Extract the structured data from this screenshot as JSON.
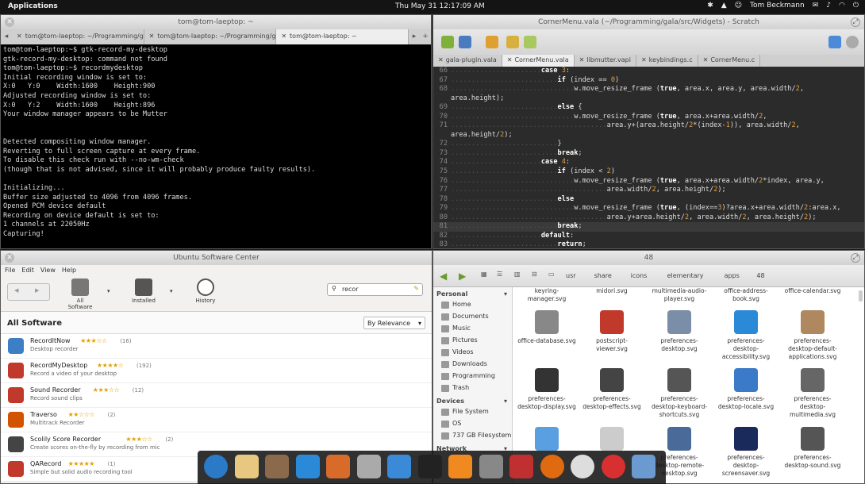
{
  "panel": {
    "apps": "Applications",
    "clock": "Thu May 31 12:17:09 AM",
    "user": "Tom Beckmann"
  },
  "terminal": {
    "title": "tom@tom-laeptop: ~",
    "tabs": [
      "tom@tom-laeptop: ~/Programming/gala/build",
      "tom@tom-laeptop: ~/Programming/gala/build",
      "tom@tom-laeptop: ~"
    ],
    "lines": [
      "tom@tom-laeptop:~$ gtk-record-my-desktop",
      "gtk-record-my-desktop: command not found",
      "tom@tom-laeptop:~$ recordmydesktop",
      "Initial recording window is set to:",
      "X:0   Y:0    Width:1600    Height:900",
      "Adjusted recording window is set to:",
      "X:0   Y:2    Width:1600    Height:896",
      "Your window manager appears to be Mutter",
      "",
      "",
      "Detected compositing window manager.",
      "Reverting to full screen capture at every frame.",
      "To disable this check run with --no-wm-check",
      "(though that is not advised, since it will probably produce faulty results).",
      "",
      "Initializing...",
      "Buffer size adjusted to 4096 from 4096 frames.",
      "Opened PCM device default",
      "Recording on device default is set to:",
      "1 channels at 22050Hz",
      "Capturing!"
    ]
  },
  "editor": {
    "title": "CornerMenu.vala (~/Programming/gala/src/Widgets) - Scratch",
    "tabs": [
      "gala-plugin.vala",
      "CornerMenu.vala",
      "libmutter.vapi",
      "keybindings.c",
      "CornerMenu.c"
    ],
    "lines": [
      {
        "n": "66",
        "t": "......................case 3:"
      },
      {
        "n": "67",
        "t": "..........................if (index == 0)"
      },
      {
        "n": "68",
        "t": "..............................w.move_resize_frame (true, area.x, area.y, area.width/2,"
      },
      {
        "n": "",
        "t": "area.height);"
      },
      {
        "n": "69",
        "t": "..........................else {"
      },
      {
        "n": "70",
        "t": "..............................w.move_resize_frame (true, area.x+area.width/2,"
      },
      {
        "n": "71",
        "t": "......................................area.y+(area.height/2*(index-1)), area.width/2,"
      },
      {
        "n": "",
        "t": "area.height/2);"
      },
      {
        "n": "72",
        "t": "..........................}"
      },
      {
        "n": "73",
        "t": "..........................break;"
      },
      {
        "n": "74",
        "t": "......................case 4:"
      },
      {
        "n": "75",
        "t": "..........................if (index < 2)"
      },
      {
        "n": "76",
        "t": "..............................w.move_resize_frame (true, area.x+area.width/2*index, area.y,"
      },
      {
        "n": "77",
        "t": "......................................area.width/2, area.height/2);"
      },
      {
        "n": "78",
        "t": "..........................else"
      },
      {
        "n": "79",
        "t": "..............................w.move_resize_frame (true, (index==3)?area.x+area.width/2:area.x,"
      },
      {
        "n": "80",
        "t": "......................................area.y+area.height/2, area.width/2, area.height/2);"
      },
      {
        "n": "81",
        "t": "..........................break;"
      },
      {
        "n": "82",
        "t": "......................default:"
      },
      {
        "n": "83",
        "t": "..........................return;"
      }
    ],
    "current_line": "81"
  },
  "usc": {
    "title": "Ubuntu Software Center",
    "menu": [
      "File",
      "Edit",
      "View",
      "Help"
    ],
    "toolbar": {
      "all": "All Software",
      "installed": "Installed",
      "history": "History"
    },
    "search": "recor",
    "heading": "All Software",
    "sort": "By Relevance",
    "apps": [
      {
        "name": "RecordItNow",
        "desc": "Desktop recorder",
        "stars": "★★★☆☆",
        "count": "(16)",
        "color": "#3d7fc4"
      },
      {
        "name": "RecordMyDesktop",
        "desc": "Record a video of your desktop",
        "stars": "★★★★☆",
        "count": "(192)",
        "color": "#c0392b"
      },
      {
        "name": "Sound Recorder",
        "desc": "Record sound clips",
        "stars": "★★★☆☆",
        "count": "(12)",
        "color": "#c0392b"
      },
      {
        "name": "Traverso",
        "desc": "Multitrack Recorder",
        "stars": "★★☆☆☆",
        "count": "(2)",
        "color": "#d35400"
      },
      {
        "name": "Scolily Score Recorder",
        "desc": "Create scores on-the-fly by recording from mic",
        "stars": "★★★☆☆",
        "count": "(2)",
        "color": "#444"
      },
      {
        "name": "QARecord",
        "desc": "Simple but solid audio recording tool",
        "stars": "★★★★★",
        "count": "(1)",
        "color": "#c0392b"
      }
    ]
  },
  "fm": {
    "title": "48",
    "crumbs": [
      "usr",
      "share",
      "icons",
      "elementary",
      "apps",
      "48"
    ],
    "sidebar": {
      "personal": "Personal",
      "personal_items": [
        "Home",
        "Documents",
        "Music",
        "Pictures",
        "Videos",
        "Downloads",
        "Programming",
        "Trash"
      ],
      "devices": "Devices",
      "device_items": [
        "File System",
        "OS",
        "737 GB Filesystem"
      ],
      "network": "Network"
    },
    "top_row": [
      "keyring-manager.svg",
      "midori.svg",
      "multimedia-audio-\nplayer.svg",
      "office-address-\nbook.svg",
      "office-calendar.svg"
    ],
    "files": [
      {
        "label": "office-database.svg",
        "color": "#888"
      },
      {
        "label": "postscript-viewer.svg",
        "color": "#c0392b"
      },
      {
        "label": "preferences-\ndesktop.svg",
        "color": "#7a8ea8"
      },
      {
        "label": "preferences-\ndesktop-\naccessibility.svg",
        "color": "#2a8ad8"
      },
      {
        "label": "preferences-\ndesktop-default-\napplications.svg",
        "color": "#b08860"
      },
      {
        "label": "preferences-\ndesktop-display.svg",
        "color": "#333"
      },
      {
        "label": "preferences-\ndesktop-effects.svg",
        "color": "#444"
      },
      {
        "label": "preferences-\ndesktop-keyboard-\nshortcuts.svg",
        "color": "#555"
      },
      {
        "label": "preferences-\ndesktop-locale.svg",
        "color": "#3a7ac8"
      },
      {
        "label": "preferences-\ndesktop-\nmultimedia.svg",
        "color": "#666"
      },
      {
        "label": "",
        "color": "#5aa0e0"
      },
      {
        "label": "",
        "color": "#ccc"
      },
      {
        "label": "preferences-\ndesktop-remote-\ndesktop.svg",
        "color": "#4a6a9a"
      },
      {
        "label": "preferences-\ndesktop-\nscreensaver.svg",
        "color": "#1a2a5a"
      },
      {
        "label": "preferences-\ndesktop-sound.svg",
        "color": "#555"
      }
    ]
  },
  "dock": [
    {
      "name": "web-browser",
      "color": "#2a7ac8"
    },
    {
      "name": "mail",
      "color": "#e8c880"
    },
    {
      "name": "contacts",
      "color": "#8a6a4a"
    },
    {
      "name": "messaging",
      "color": "#2a8ad8"
    },
    {
      "name": "photos",
      "color": "#d86a2a"
    },
    {
      "name": "preferences",
      "color": "#aaa"
    },
    {
      "name": "downloads",
      "color": "#3a8ad8"
    },
    {
      "name": "terminal",
      "color": "#222"
    },
    {
      "name": "music",
      "color": "#f08a20"
    },
    {
      "name": "text-editor",
      "color": "#888"
    },
    {
      "name": "screen-recorder",
      "color": "#c03030"
    },
    {
      "name": "firefox",
      "color": "#e06a10"
    },
    {
      "name": "clock",
      "color": "#ddd"
    },
    {
      "name": "record",
      "color": "#d83030"
    },
    {
      "name": "files",
      "color": "#6a9ad0"
    }
  ]
}
